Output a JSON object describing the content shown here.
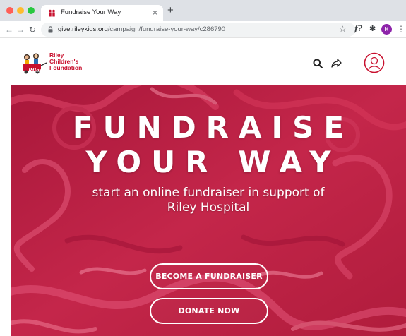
{
  "browser": {
    "tab_title": "Fundraise Your Way",
    "tab_close": "×",
    "new_tab": "+",
    "url_host": "give.rileykids.org",
    "url_path": "/campaign/fundraise-your-way/c286790",
    "profile_initial": "H",
    "extension_label": "f?",
    "icons": [
      "back-arrow-icon",
      "forward-arrow-icon",
      "reload-icon",
      "lock-icon",
      "star-icon",
      "puzzle-icon",
      "menu-dots-icon"
    ]
  },
  "site": {
    "logo_lines": [
      "Riley",
      "Children's",
      "Foundation"
    ],
    "logo_badge": "Riley",
    "brand_color": "#c8102e",
    "header_icons": [
      "search-icon",
      "share-icon",
      "account-icon"
    ]
  },
  "hero": {
    "title_line1": "FUNDRAISE",
    "title_line2": "YOUR WAY",
    "subtitle_line1": "start an online fundraiser in support of",
    "subtitle_line2": "Riley Hospital",
    "cta_primary": "BECOME A FUNDRAISER",
    "cta_secondary": "DONATE NOW",
    "background_color": "#b8203f"
  }
}
